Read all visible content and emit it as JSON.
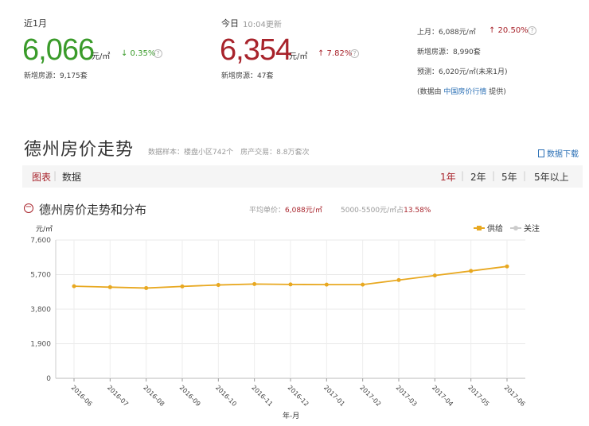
{
  "summary": {
    "month": {
      "label": "近1月",
      "price": "6,066",
      "unit": "元/㎡",
      "change": "↓ 0.35%",
      "new_listings": "新增房源：9,175套"
    },
    "today": {
      "label": "今日",
      "time": "10:04更新",
      "price": "6,354",
      "unit": "元/㎡",
      "change": "↑ 7.82%",
      "new_listings": "新增房源：47套"
    },
    "side": {
      "last_month": "上月：6,088元/㎡",
      "last_month_change": "↑ 20.50%",
      "new_listings": "新增房源：8,990套",
      "forecast": "预测：6,020元/㎡(未来1月)",
      "source_prefix": "(数据由",
      "source_link": "中国房价行情",
      "source_suffix": "提供)"
    }
  },
  "section": {
    "title": "德州房价走势",
    "sample": "数据样本：楼盘小区742个　房产交易：8.8万套次",
    "download": "数据下载"
  },
  "tabs": {
    "chart": "图表",
    "data": "数据",
    "periods": [
      "1年",
      "2年",
      "5年",
      "5年以上"
    ]
  },
  "chart_header": {
    "title": "德州房价走势和分布",
    "avg_label": "平均单价：",
    "avg_value": "6,088元/㎡",
    "range_label": "5000-5500元/㎡占",
    "range_value": "13.58%"
  },
  "colors": {
    "green": "#3a9b2a",
    "red": "#a8232b",
    "series": "#e8a820"
  },
  "chart_data": {
    "type": "line",
    "ylabel": "元/㎡",
    "xlabel": "年-月",
    "ylim": [
      0,
      7600
    ],
    "yticks": [
      "0",
      "1,900",
      "3,800",
      "5,700",
      "7,600"
    ],
    "categories": [
      "2016-06",
      "2016-07",
      "2016-08",
      "2016-09",
      "2016-10",
      "2016-11",
      "2016-12",
      "2017-01",
      "2017-02",
      "2017-03",
      "2017-04",
      "2017-05",
      "2017-06"
    ],
    "series": [
      {
        "name": "供给",
        "values": [
          5060,
          5010,
          4960,
          5050,
          5130,
          5180,
          5160,
          5150,
          5150,
          5400,
          5650,
          5900,
          6150
        ]
      }
    ],
    "legend": [
      "供给",
      "关注"
    ],
    "legend_position": "top-right"
  }
}
